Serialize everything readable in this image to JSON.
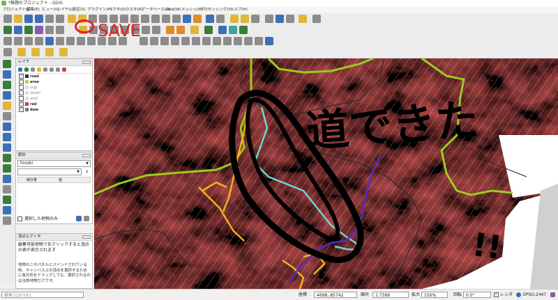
{
  "window": {
    "title": "*無題のプロジェクト - QGIS"
  },
  "menu": [
    "プロジェクト(J)",
    "編集(E)",
    "ビュー(V)",
    "レイヤ(L)",
    "設定(S)",
    "プラグイン(P)",
    "ベクタ(O)",
    "ラスタ(R)",
    "データベース(D)",
    "Web(W)",
    "メッシュ(M)",
    "プロセッシング(C)",
    "ヘルプ(H)"
  ],
  "layers_panel": {
    "title": "レイヤ",
    "layers": [
      {
        "name": "road",
        "checked": true
      },
      {
        "name": "area",
        "checked": true
      },
      {
        "name": "sugi",
        "checked": false
      },
      {
        "name": "hinoki",
        "checked": false
      },
      {
        "name": "ariol",
        "checked": false
      },
      {
        "name": "red",
        "checked": true
      },
      {
        "name": "dem",
        "checked": true
      }
    ]
  },
  "stats_panel": {
    "title": "統計",
    "layer_select": "hinoki",
    "col_stat": "統計量",
    "col_value": "値",
    "selected_only": "選択した地物のみ"
  },
  "vertex_panel": {
    "title": "頂点エディタ",
    "hint1": "編集可能地物で右クリックすると頂点の表が表示されます",
    "hint2": "地物のこのパネルにパインドされている時、キャンバス上の頂点を選択するために長方形をドラッグしても、選択されるのは当該地物だけです。"
  },
  "annotations": {
    "save": "SAVE",
    "message_main": "道できた",
    "message_end": "!!"
  },
  "search": {
    "placeholder": "検索 (Ctrl+K)"
  },
  "status": {
    "coord_label": "座標",
    "coord_value": "4698,-85742",
    "scale_label": "縮尺",
    "scale_value": "1:7399",
    "mag_label": "拡大",
    "mag_value": "150%",
    "rot_label": "回転",
    "rot_value": "0.0°",
    "render_label": "レンダ",
    "crs": "EPSG:2447"
  }
}
